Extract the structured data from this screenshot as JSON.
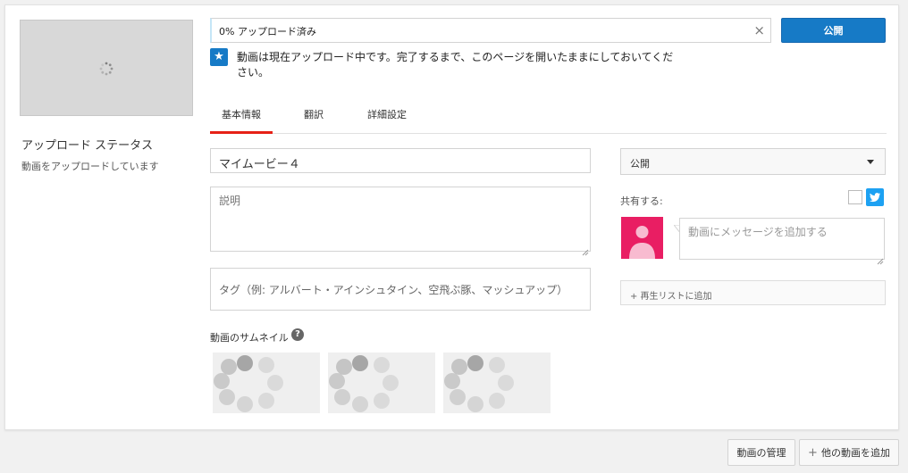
{
  "status": {
    "title": "アップロード ステータス",
    "subtitle": "動画をアップロードしています"
  },
  "upload": {
    "progress_text": "0% アップロード済み",
    "progress_percent": 0,
    "notice": "動画は現在アップロード中です。完了するまで、このページを開いたままにしておいてください。",
    "publish_label": "公開"
  },
  "tabs": [
    {
      "label": "基本情報",
      "active": true
    },
    {
      "label": "翻訳",
      "active": false
    },
    {
      "label": "詳細設定",
      "active": false
    }
  ],
  "form": {
    "title_value": "マイムービー４",
    "description_placeholder": "説明",
    "tags_placeholder": "タグ（例: アルバート・アインシュタイン、空飛ぶ豚、マッシュアップ）"
  },
  "thumbnails": {
    "label": "動画のサムネイル",
    "help_glyph": "?"
  },
  "sidebar": {
    "privacy_value": "公開",
    "share_label": "共有する:",
    "message_placeholder": "動画にメッセージを追加する",
    "playlist_label": "+ 再生リストに追加"
  },
  "footer": {
    "manage_label": "動画の管理",
    "add_more_label": "他の動画を追加"
  },
  "colors": {
    "primary": "#167ac6",
    "tab_active": "#e62117",
    "avatar_bg": "#e91e63",
    "twitter": "#1da1f2"
  },
  "icons": {
    "notice": "star-icon",
    "close": "close-icon",
    "help": "help-icon",
    "dropdown": "caret-down-icon",
    "twitter": "twitter-icon",
    "avatar": "user-avatar-icon",
    "add": "plus-icon",
    "spinner": "loading-spinner-icon"
  }
}
